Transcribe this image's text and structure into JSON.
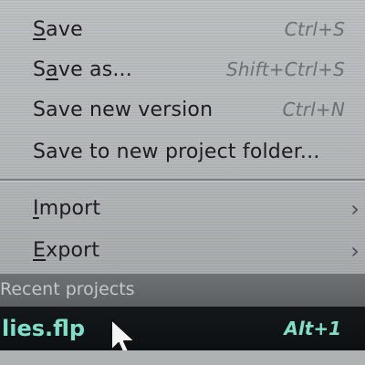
{
  "menu": {
    "items": [
      {
        "label": "Save",
        "underline": "S",
        "shortcut": "Ctrl+S"
      },
      {
        "label": "Save as...",
        "underline": "a",
        "shortcut": "Shift+Ctrl+S"
      },
      {
        "label": "Save new version",
        "shortcut": "Ctrl+N"
      },
      {
        "label": "Save to new project folder..."
      },
      {
        "label": "Import",
        "underline": "I"
      },
      {
        "label": "Export",
        "underline": "E"
      }
    ],
    "section_header": "Recent projects",
    "recent": [
      {
        "label": "lies.flp",
        "shortcut": "Alt+1"
      }
    ]
  },
  "colors": {
    "menu_bg": "#b4b8b9",
    "text": "#1c1d20",
    "shortcut_text": "#6c7073",
    "highlight_bg": "#101315",
    "highlight_text": "#7ee0c8"
  },
  "icons": [
    "chevron-right-icon",
    "mouse-cursor-icon"
  ]
}
